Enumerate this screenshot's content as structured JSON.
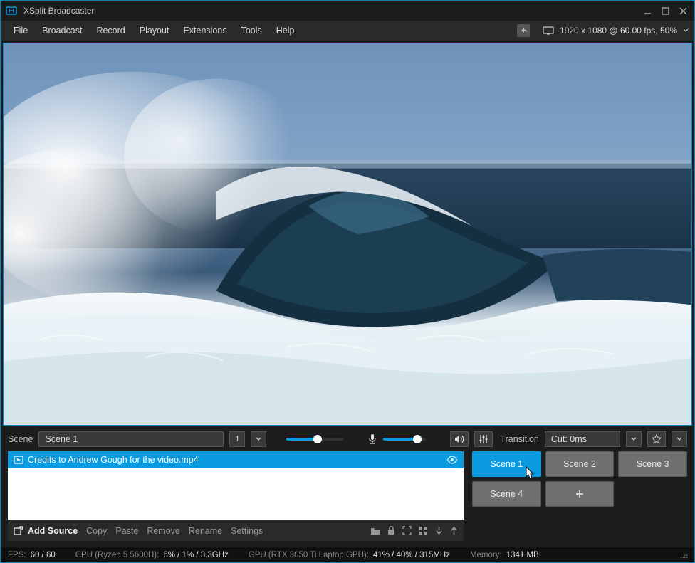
{
  "window": {
    "title": "XSplit Broadcaster"
  },
  "menu": {
    "items": [
      "File",
      "Broadcast",
      "Record",
      "Playout",
      "Extensions",
      "Tools",
      "Help"
    ],
    "resolution": "1920 x 1080 @ 60.00 fps, 50%"
  },
  "scenebar": {
    "label": "Scene",
    "name": "Scene 1",
    "preset": "1"
  },
  "audio": {
    "output_pct": 55,
    "mic_pct": 80
  },
  "transition": {
    "label": "Transition",
    "value": "Cut: 0ms"
  },
  "sources": {
    "items": [
      {
        "label": "Credits to Andrew Gough for the video.mp4"
      }
    ],
    "toolbar": {
      "add": "Add Source",
      "copy": "Copy",
      "paste": "Paste",
      "remove": "Remove",
      "rename": "Rename",
      "settings": "Settings"
    }
  },
  "scenes": {
    "buttons": [
      "Scene 1",
      "Scene 2",
      "Scene 3",
      "Scene 4"
    ],
    "active": 0
  },
  "status": {
    "fps_label": "FPS:",
    "fps": "60 / 60",
    "cpu_label": "CPU (Ryzen 5 5600H):",
    "cpu": "6% / 1% / 3.3GHz",
    "gpu_label": "GPU (RTX 3050 Ti Laptop GPU):",
    "gpu": "41% / 40% / 315MHz",
    "mem_label": "Memory:",
    "mem": "1341 MB"
  }
}
